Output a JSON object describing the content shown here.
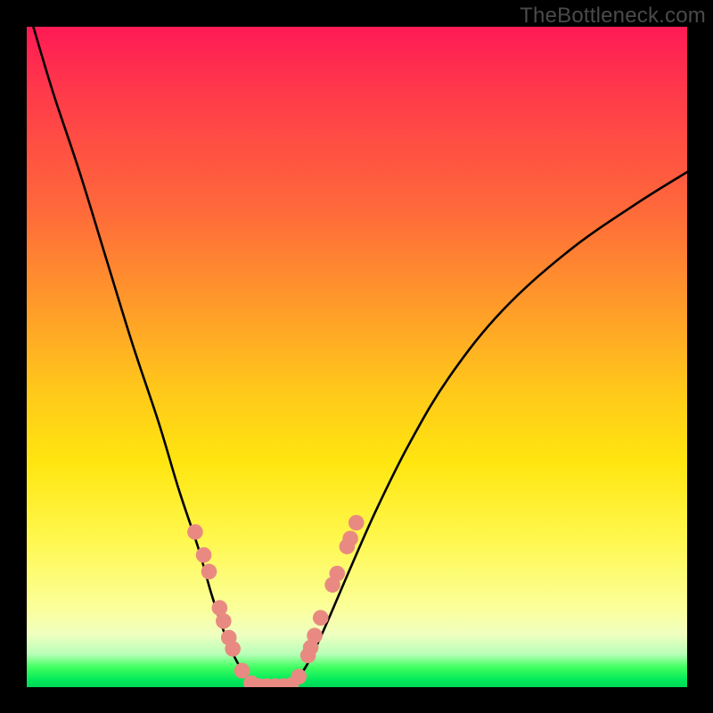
{
  "watermark": "TheBottleneck.com",
  "chart_data": {
    "type": "line",
    "title": "",
    "xlabel": "",
    "ylabel": "",
    "xlim": [
      0,
      100
    ],
    "ylim": [
      0,
      100
    ],
    "gradient_stops": [
      {
        "pos": 0,
        "color": "#ff1a55"
      },
      {
        "pos": 28,
        "color": "#ff6a3a"
      },
      {
        "pos": 55,
        "color": "#ffc81a"
      },
      {
        "pos": 78,
        "color": "#fff850"
      },
      {
        "pos": 92,
        "color": "#f0ffc0"
      },
      {
        "pos": 100,
        "color": "#00d858"
      }
    ],
    "series": [
      {
        "name": "left-curve",
        "x": [
          1,
          4,
          8,
          12,
          16,
          20,
          23,
          26,
          28,
          30,
          31.5,
          33,
          34.2,
          35
        ],
        "y": [
          100,
          90,
          78,
          65,
          52,
          40,
          30,
          21,
          14,
          8,
          4.5,
          2,
          0.6,
          0
        ]
      },
      {
        "name": "floor-segment",
        "x": [
          35,
          36,
          37,
          38.5,
          40
        ],
        "y": [
          0,
          0,
          0,
          0,
          0
        ]
      },
      {
        "name": "right-curve",
        "x": [
          40,
          41,
          42.5,
          44,
          46,
          49,
          53,
          58,
          64,
          72,
          82,
          92,
          100
        ],
        "y": [
          0,
          1.2,
          3.5,
          6.5,
          11,
          18,
          27,
          37,
          47,
          57,
          66,
          73,
          78
        ]
      }
    ],
    "markers": {
      "name": "highlight-dots",
      "color": "#e98a82",
      "radius": 8.8,
      "points": [
        {
          "x": 25.5,
          "y": 23.5
        },
        {
          "x": 26.8,
          "y": 20.0
        },
        {
          "x": 27.6,
          "y": 17.5
        },
        {
          "x": 29.2,
          "y": 12.0
        },
        {
          "x": 29.8,
          "y": 10.0
        },
        {
          "x": 30.6,
          "y": 7.5
        },
        {
          "x": 31.2,
          "y": 5.8
        },
        {
          "x": 32.6,
          "y": 2.5
        },
        {
          "x": 34.0,
          "y": 0.6
        },
        {
          "x": 35.2,
          "y": 0.15
        },
        {
          "x": 36.4,
          "y": 0.15
        },
        {
          "x": 37.6,
          "y": 0.15
        },
        {
          "x": 38.8,
          "y": 0.15
        },
        {
          "x": 40.0,
          "y": 0.3
        },
        {
          "x": 41.2,
          "y": 1.6
        },
        {
          "x": 42.6,
          "y": 4.8
        },
        {
          "x": 43.0,
          "y": 6.0
        },
        {
          "x": 43.6,
          "y": 7.8
        },
        {
          "x": 44.5,
          "y": 10.5
        },
        {
          "x": 46.3,
          "y": 15.5
        },
        {
          "x": 47.0,
          "y": 17.2
        },
        {
          "x": 48.5,
          "y": 21.3
        },
        {
          "x": 49.0,
          "y": 22.5
        },
        {
          "x": 49.9,
          "y": 24.9
        }
      ]
    }
  }
}
